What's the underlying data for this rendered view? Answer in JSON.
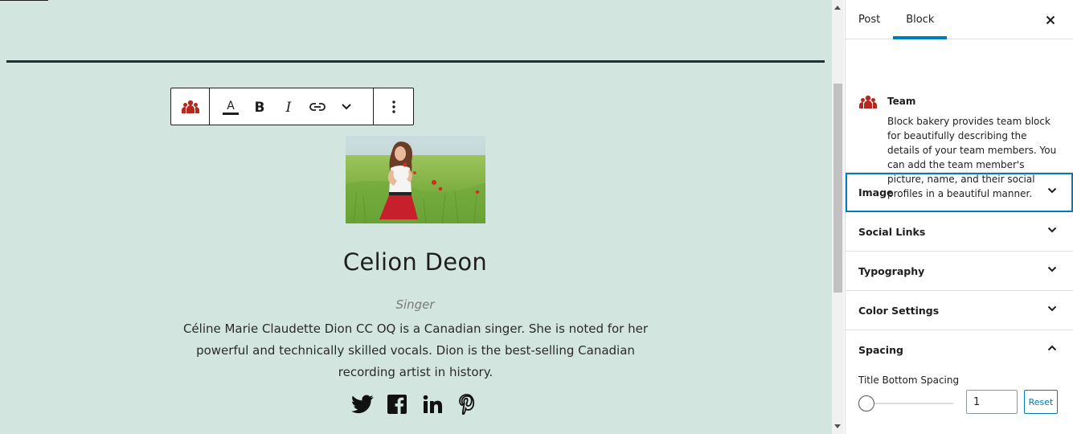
{
  "colors": {
    "canvas_bg": "#d3e5df",
    "accent": "#007cba",
    "team_icon": "#b5281f",
    "text": "#1e1e1e"
  },
  "toolbar": {
    "block_icon": "team-icon",
    "buttons": [
      "text-color-icon",
      "bold-icon",
      "italic-icon",
      "link-icon",
      "chevron-down-icon",
      "more-options-icon"
    ],
    "text_color_letter": "A",
    "bold_letter": "B",
    "italic_letter": "I"
  },
  "member": {
    "name": "Celion Deon",
    "role": "Singer",
    "bio": "Céline Marie Claudette Dion CC OQ is a Canadian singer. She is noted for her powerful and technically skilled vocals. Dion is the best-selling Canadian recording artist in history.",
    "socials": [
      "twitter-icon",
      "facebook-icon",
      "linkedin-icon",
      "pinterest-icon"
    ]
  },
  "sidebar": {
    "tabs": [
      {
        "label": "Post",
        "active": false
      },
      {
        "label": "Block",
        "active": true
      }
    ],
    "block": {
      "title": "Team",
      "description": "Block bakery provides team block for beautifully describing the details of your team members. You can add the team member's picture, name, and their social profiles in a beautiful manner."
    },
    "panels": [
      {
        "label": "Image",
        "open": false
      },
      {
        "label": "Social Links",
        "open": false
      },
      {
        "label": "Typography",
        "open": false
      },
      {
        "label": "Color Settings",
        "open": false
      },
      {
        "label": "Spacing",
        "open": true
      }
    ],
    "spacing": {
      "field_label": "Title Bottom Spacing",
      "value": "1",
      "reset_label": "Reset"
    }
  }
}
